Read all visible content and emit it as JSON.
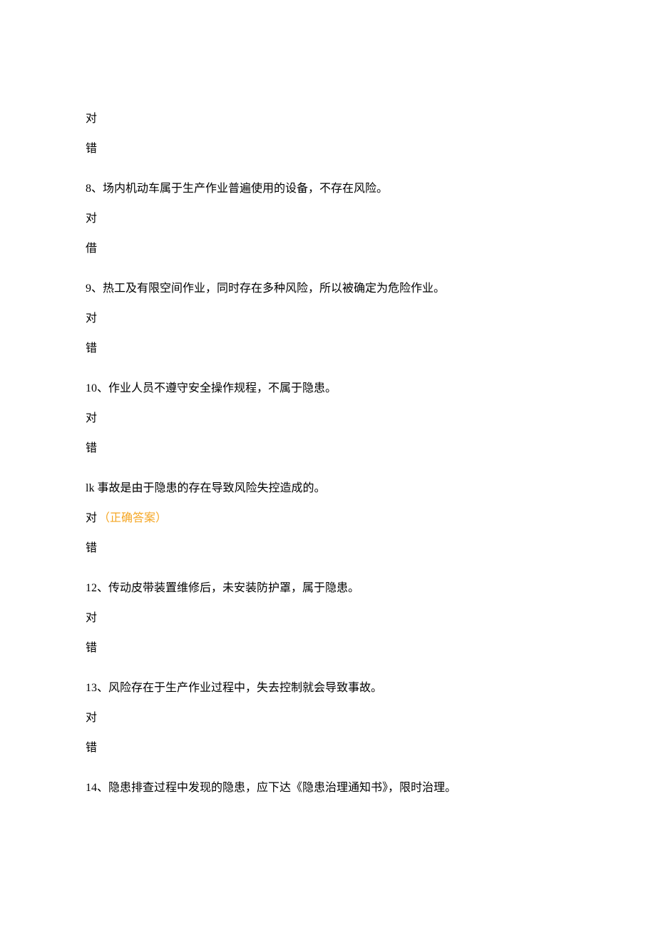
{
  "colors": {
    "text": "#000000",
    "correct": "#f5a623",
    "bg": "#ffffff"
  },
  "labels": {
    "true": "对",
    "false": "错",
    "correct_answer": "（正确答案）"
  },
  "questions": {
    "q_top": {
      "opt_true": "对",
      "opt_false": "错"
    },
    "q8": {
      "text": "8、场内机动车属于生产作业普遍使用的设备，不存在风险。",
      "opt_true": "对",
      "opt_false": "借"
    },
    "q9": {
      "text": "9、热工及有限空间作业，同时存在多种风险，所以被确定为危险作业。",
      "opt_true": "对",
      "opt_false": "错"
    },
    "q10": {
      "text": "10、作业人员不遵守安全操作规程，不属于隐患。",
      "opt_true": "对",
      "opt_false": "错"
    },
    "q_lk": {
      "text": "lk 事故是由于隐患的存在导致风险失控造成的。",
      "opt_true": "对",
      "opt_false": "错"
    },
    "q12": {
      "text": "12、传动皮带装置维修后，未安装防护罩，属于隐患。",
      "opt_true": "对",
      "opt_false": "错"
    },
    "q13": {
      "text": "13、风险存在于生产作业过程中，失去控制就会导致事故。",
      "opt_true": "对",
      "opt_false": "错"
    },
    "q14": {
      "text": "14、隐患排查过程中发现的隐患，应下达《隐患治理通知书》，限时治理。"
    }
  }
}
